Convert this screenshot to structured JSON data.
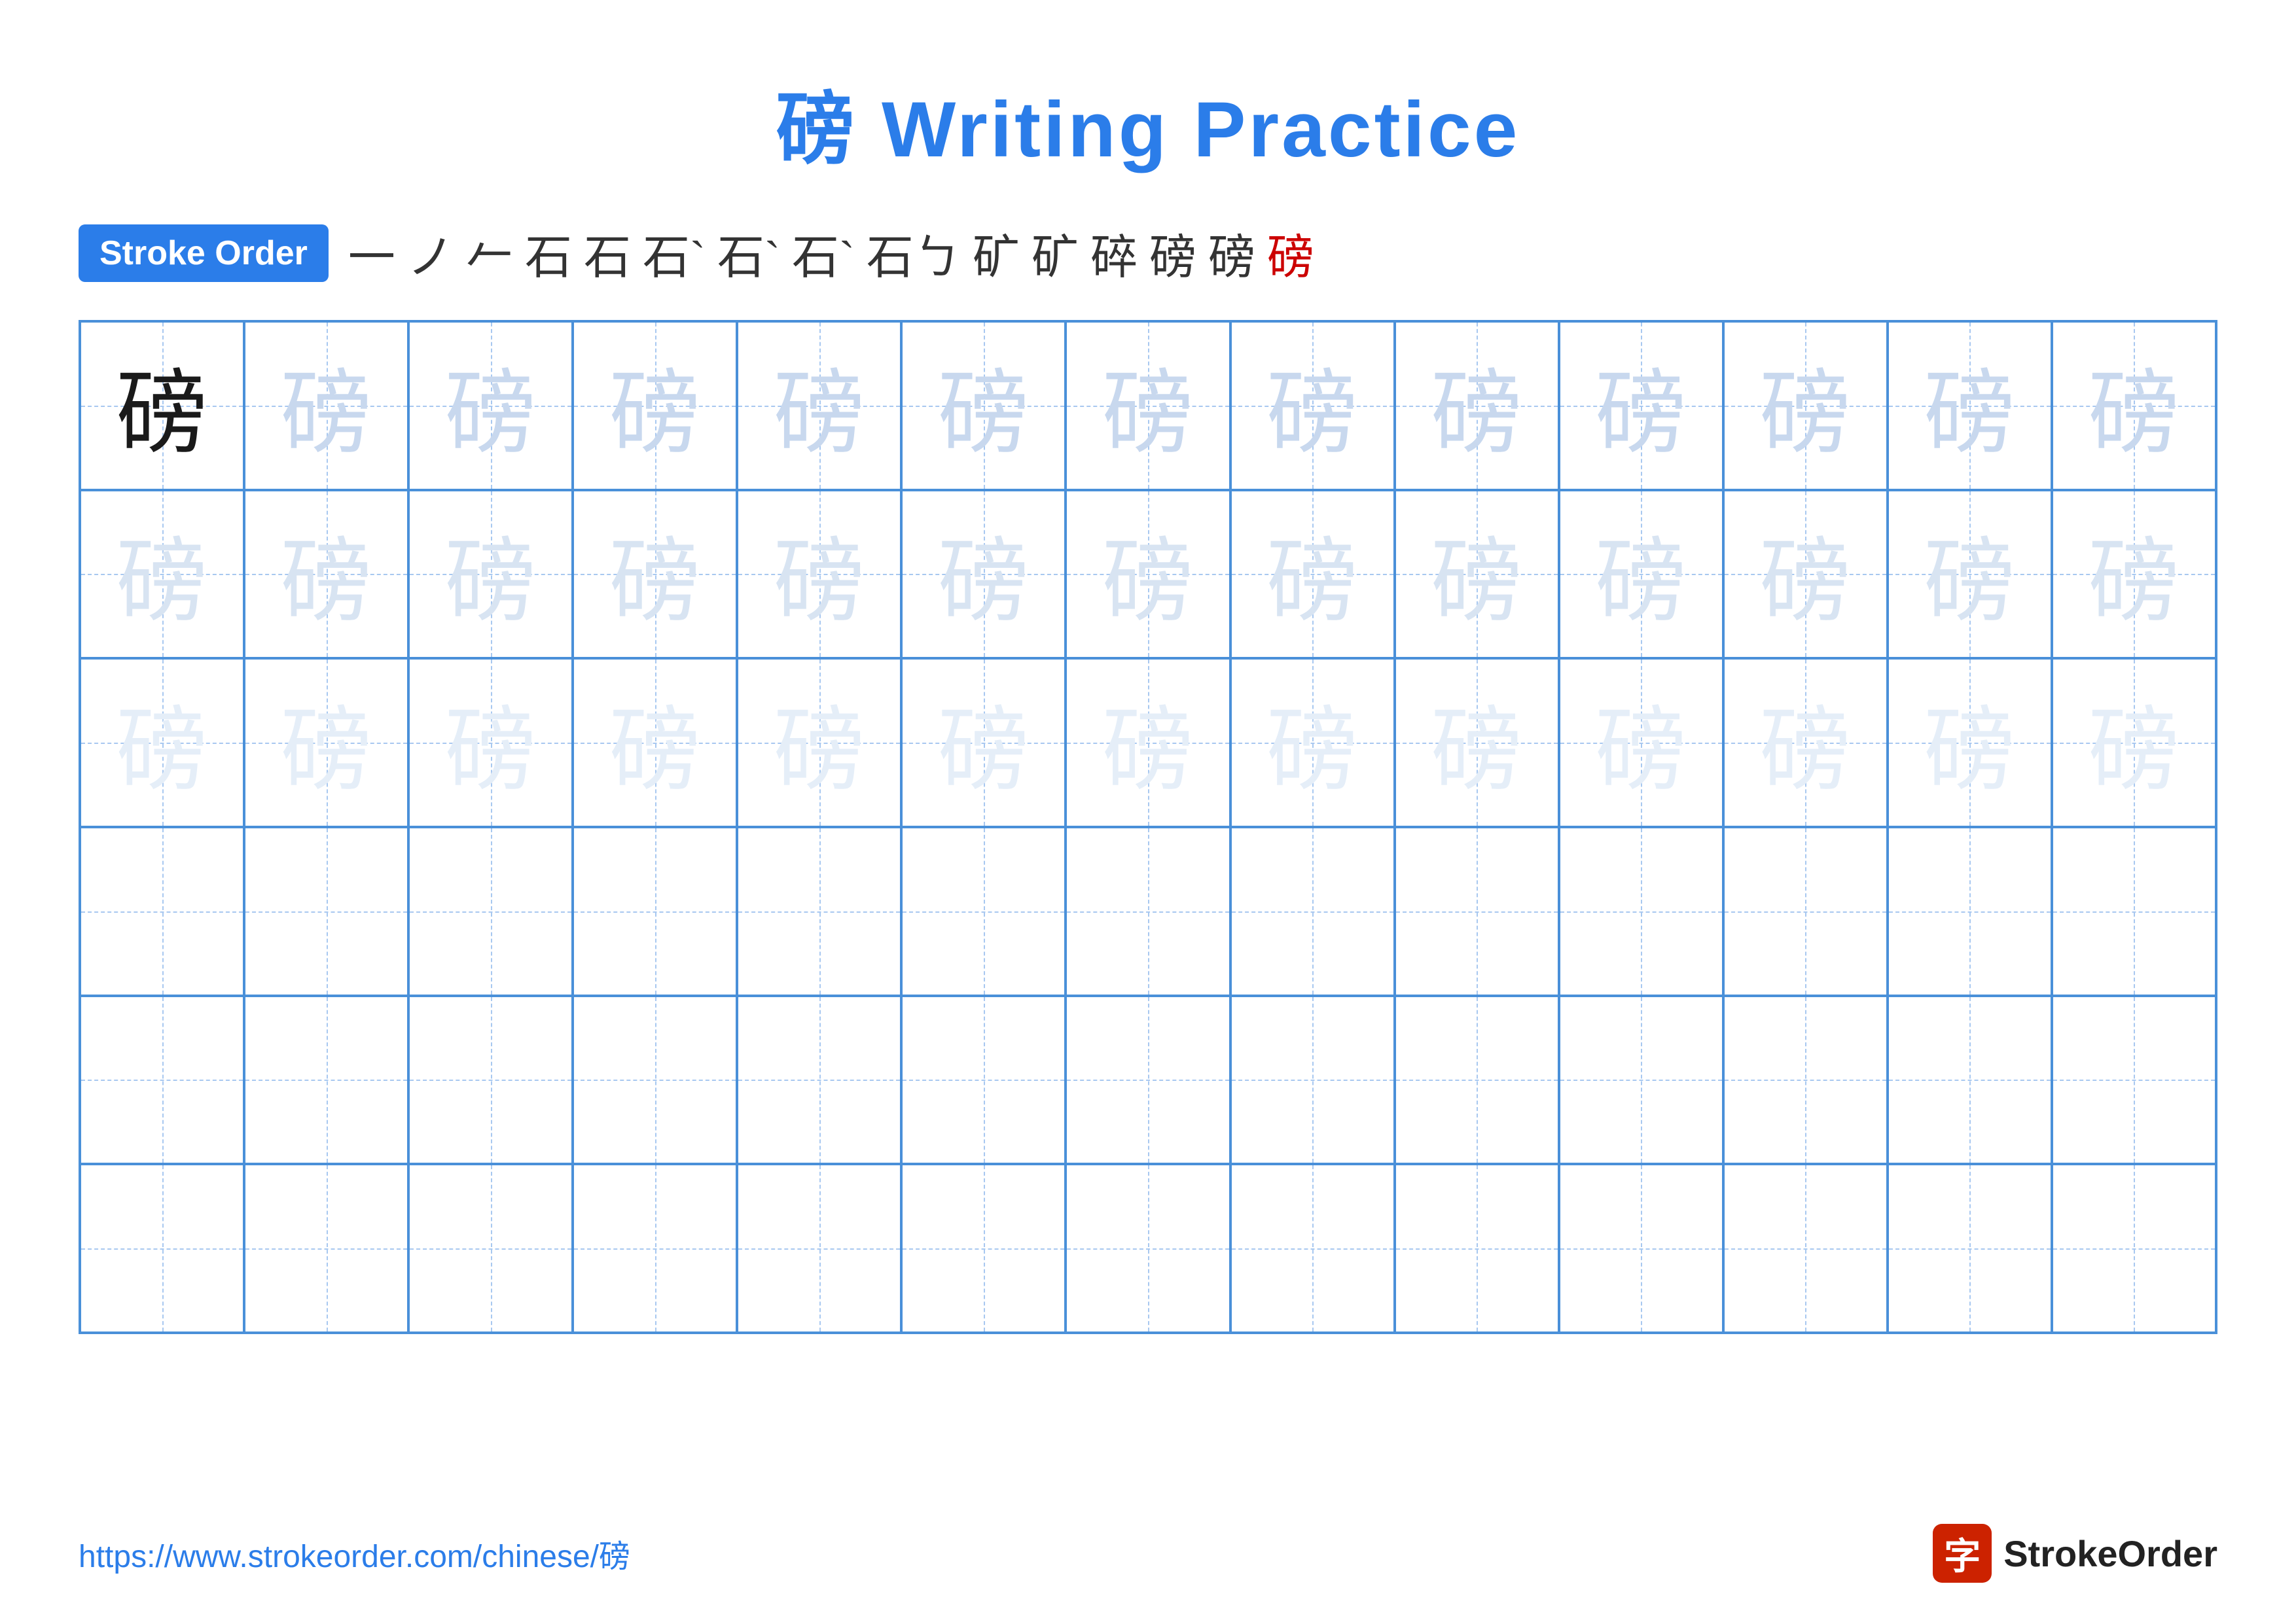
{
  "title": "磅 Writing Practice",
  "stroke_order_badge": "Stroke Order",
  "stroke_steps": [
    "一",
    "ノ",
    "𠂉",
    "石",
    "石",
    "石`",
    "石`",
    "石`",
    "石ㄅ",
    "矿",
    "矿",
    "碎",
    "磅",
    "磅",
    "磅"
  ],
  "character": "磅",
  "rows": [
    {
      "type": "dark_then_light1",
      "dark_count": 1,
      "total": 13
    },
    {
      "type": "light2",
      "total": 13
    },
    {
      "type": "very_light",
      "total": 13
    },
    {
      "type": "empty",
      "total": 13
    },
    {
      "type": "empty",
      "total": 13
    },
    {
      "type": "empty",
      "total": 13
    }
  ],
  "footer": {
    "url": "https://www.strokeorder.com/chinese/磅",
    "brand": "StrokeOrder",
    "logo_char": "字"
  }
}
